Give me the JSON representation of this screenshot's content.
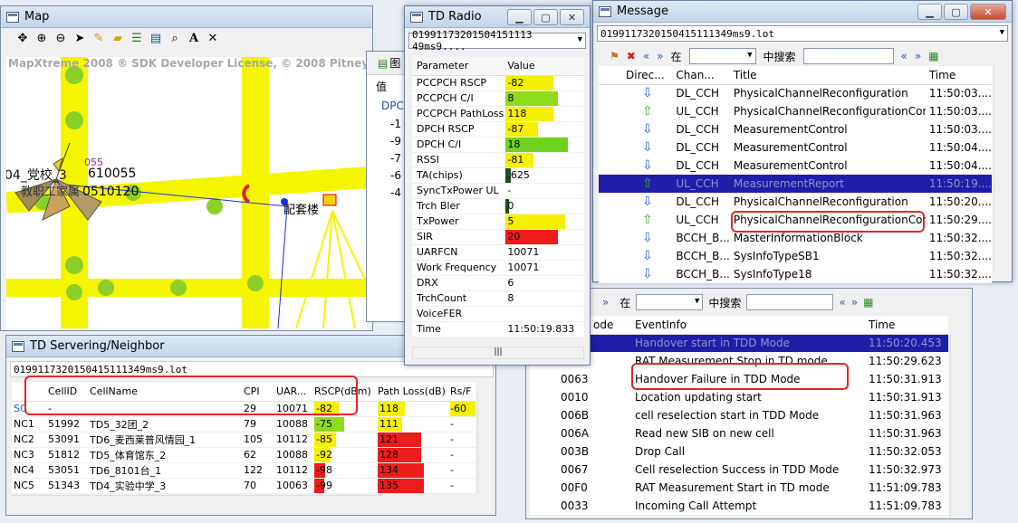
{
  "map": {
    "title": "Map",
    "license": "MapXtreme 2008 ® SDK Developer License, © 2008 Pitney B",
    "labels": [
      "04_党校_3",
      "610055",
      "0510120",
      "055",
      "教职工家属",
      "配套楼",
      "055"
    ],
    "tools": [
      "pan-icon",
      "zoom-in-icon",
      "zoom-out-icon",
      "pointer-icon",
      "ruler-icon",
      "folder-icon",
      "layers-icon",
      "legend-icon",
      "find-icon",
      "text-icon",
      "clear-icon"
    ]
  },
  "back_panel": {
    "title": "图",
    "col": "值",
    "row_head": "DPC",
    "values": [
      "-1",
      "-9",
      "-7",
      "-6",
      "-4"
    ]
  },
  "td_radio": {
    "title": "TD Radio",
    "file": "01991173201504151113 49ms9....",
    "headers": [
      "Parameter",
      "Value"
    ],
    "rows": [
      {
        "p": "PCCPCH RSCP",
        "v": "-82",
        "color": "#f5f000",
        "fill": 0.6
      },
      {
        "p": "PCCPCH C/I",
        "v": "8",
        "color": "#8edb1c",
        "fill": 0.65
      },
      {
        "p": "PCCPCH PathLoss",
        "v": "118",
        "color": "#f5f000",
        "fill": 0.6
      },
      {
        "p": "DPCH RSCP",
        "v": "-87",
        "color": "#f5f000",
        "fill": 0.4
      },
      {
        "p": "DPCH C/I",
        "v": "18",
        "color": "#6dd320",
        "fill": 0.78
      },
      {
        "p": "RSSI",
        "v": "-81",
        "color": "#f5f000",
        "fill": 0.35
      },
      {
        "p": "TA(chips)",
        "v": ".625",
        "color": "#1f4d1f",
        "fill": 0.06
      },
      {
        "p": "SyncTxPower UL",
        "v": "-",
        "color": "",
        "fill": 0
      },
      {
        "p": "Trch Bler",
        "v": "0",
        "color": "#1f4d1f",
        "fill": 0.02
      },
      {
        "p": "TxPower",
        "v": "5",
        "color": "#f5f000",
        "fill": 0.75
      },
      {
        "p": "SIR",
        "v": "20",
        "color": "#ee1c1c",
        "fill": 0.65
      },
      {
        "p": "UARFCN",
        "v": "10071",
        "color": "",
        "fill": 0
      },
      {
        "p": "Work Frequency",
        "v": "10071",
        "color": "",
        "fill": 0
      },
      {
        "p": "DRX",
        "v": "6",
        "color": "",
        "fill": 0
      },
      {
        "p": "TrchCount",
        "v": "8",
        "color": "",
        "fill": 0
      },
      {
        "p": "VoiceFER",
        "v": "",
        "color": "",
        "fill": 0
      },
      {
        "p": "Time",
        "v": "11:50:19.833",
        "color": "",
        "fill": 0
      }
    ]
  },
  "message": {
    "title": "Message",
    "file": "0199117320150415111349ms9.lot",
    "in_label": "在",
    "search_label": "中搜索",
    "headers": [
      "Direc...",
      "Chan...",
      "Title",
      "Time"
    ],
    "rows": [
      {
        "dir": "down",
        "chan": "DL_CCH",
        "title": "PhysicalChannelReconfiguration",
        "time": "11:50:03...."
      },
      {
        "dir": "up",
        "chan": "UL_CCH",
        "title": "PhysicalChannelReconfigurationCom...",
        "time": "11:50:03...."
      },
      {
        "dir": "down",
        "chan": "DL_CCH",
        "title": "MeasurementControl",
        "time": "11:50:03...."
      },
      {
        "dir": "down",
        "chan": "DL_CCH",
        "title": "MeasurementControl",
        "time": "11:50:04...."
      },
      {
        "dir": "down",
        "chan": "DL_CCH",
        "title": "MeasurementControl",
        "time": "11:50:04...."
      },
      {
        "dir": "up",
        "chan": "UL_CCH",
        "title": "MeasurementReport",
        "time": "11:50:19...."
      },
      {
        "dir": "down",
        "chan": "DL_CCH",
        "title": "PhysicalChannelReconfiguration",
        "time": "11:50:20...."
      },
      {
        "dir": "up",
        "chan": "UL_CCH",
        "title": "PhysicalChannelReconfigurationCom...",
        "time": "11:50:29...."
      },
      {
        "dir": "down",
        "chan": "BCCH_B...",
        "title": "MasterInformationBlock",
        "time": "11:50:32...."
      },
      {
        "dir": "down",
        "chan": "BCCH_B...",
        "title": "SysInfoTypeSB1",
        "time": "11:50:32...."
      },
      {
        "dir": "down",
        "chan": "BCCH_B...",
        "title": "SysInfoType18",
        "time": "11:50:32...."
      }
    ]
  },
  "events": {
    "in_label": "在",
    "search_label": "中搜索",
    "headers": [
      "ode",
      "EventInfo",
      "Time"
    ],
    "rows": [
      {
        "code": "",
        "info": "Handover start in TDD Mode",
        "time": "11:50:20.453"
      },
      {
        "code": "",
        "info": "RAT Measurement Stop in TD mode",
        "time": "11:50:29.623"
      },
      {
        "code": "0063",
        "info": "Handover Failure in TDD Mode",
        "time": "11:50:31.913"
      },
      {
        "code": "0010",
        "info": "Location updating start",
        "time": "11:50:31.913"
      },
      {
        "code": "006B",
        "info": "cell reselection start in TDD Mode",
        "time": "11:50:31.963"
      },
      {
        "code": "006A",
        "info": "Read new SIB on new cell",
        "time": "11:50:31.963"
      },
      {
        "code": "003B",
        "info": "Drop Call",
        "time": "11:50:32.053"
      },
      {
        "code": "0067",
        "info": "Cell reselection Success in TDD Mode",
        "time": "11:50:32.973"
      },
      {
        "code": "00F0",
        "info": "RAT Measurement Start in TD mode",
        "time": "11:51:09.783"
      },
      {
        "code": "0033",
        "info": "Incoming Call Attempt",
        "time": "11:51:09.783"
      }
    ]
  },
  "serving": {
    "title": "TD Servering/Neighbor",
    "file": "0199117320150415111349ms9.lot",
    "headers": [
      "",
      "CellID",
      "CellName",
      "CPI",
      "UAR...",
      "RSCP(dBm)",
      "Path Loss(dB)",
      "Rs/F"
    ],
    "rows": [
      {
        "type": "SC",
        "id": "-",
        "name": "",
        "cpi": "29",
        "uar": "10071",
        "rscp": "-82",
        "rscp_c": "#f5f000",
        "rscp_f": 0.45,
        "pl": "118",
        "pl_c": "#f5f000",
        "pl_f": 0.5,
        "rs": "-60"
      },
      {
        "type": "NC1",
        "id": "51992",
        "name": "TD5_32团_2",
        "cpi": "79",
        "uar": "10088",
        "rscp": "-75",
        "rscp_c": "#8edb1c",
        "rscp_f": 0.55,
        "pl": "111",
        "pl_c": "#f5f000",
        "pl_f": 0.45,
        "rs": "-"
      },
      {
        "type": "NC2",
        "id": "53091",
        "name": "TD6_麦西莱普风情园_1",
        "cpi": "105",
        "uar": "10112",
        "rscp": "-85",
        "rscp_c": "#f5f000",
        "rscp_f": 0.4,
        "pl": "121",
        "pl_c": "#ee1c1c",
        "pl_f": 0.8,
        "rs": "-"
      },
      {
        "type": "NC3",
        "id": "51812",
        "name": "TD5_体育馆东_2",
        "cpi": "62",
        "uar": "10088",
        "rscp": "-92",
        "rscp_c": "#f5f000",
        "rscp_f": 0.3,
        "pl": "128",
        "pl_c": "#ee1c1c",
        "pl_f": 0.8,
        "rs": "-"
      },
      {
        "type": "NC4",
        "id": "53051",
        "name": "TD6_8101台_1",
        "cpi": "122",
        "uar": "10112",
        "rscp": "-98",
        "rscp_c": "#ee1c1c",
        "rscp_f": 0.2,
        "pl": "134",
        "pl_c": "#ee1c1c",
        "pl_f": 0.85,
        "rs": "-"
      },
      {
        "type": "NC5",
        "id": "51343",
        "name": "TD4_实验中学_3",
        "cpi": "70",
        "uar": "10063",
        "rscp": "-99",
        "rscp_c": "#ee1c1c",
        "rscp_f": 0.18,
        "pl": "135",
        "pl_c": "#ee1c1c",
        "pl_f": 0.85,
        "rs": "-"
      }
    ]
  }
}
